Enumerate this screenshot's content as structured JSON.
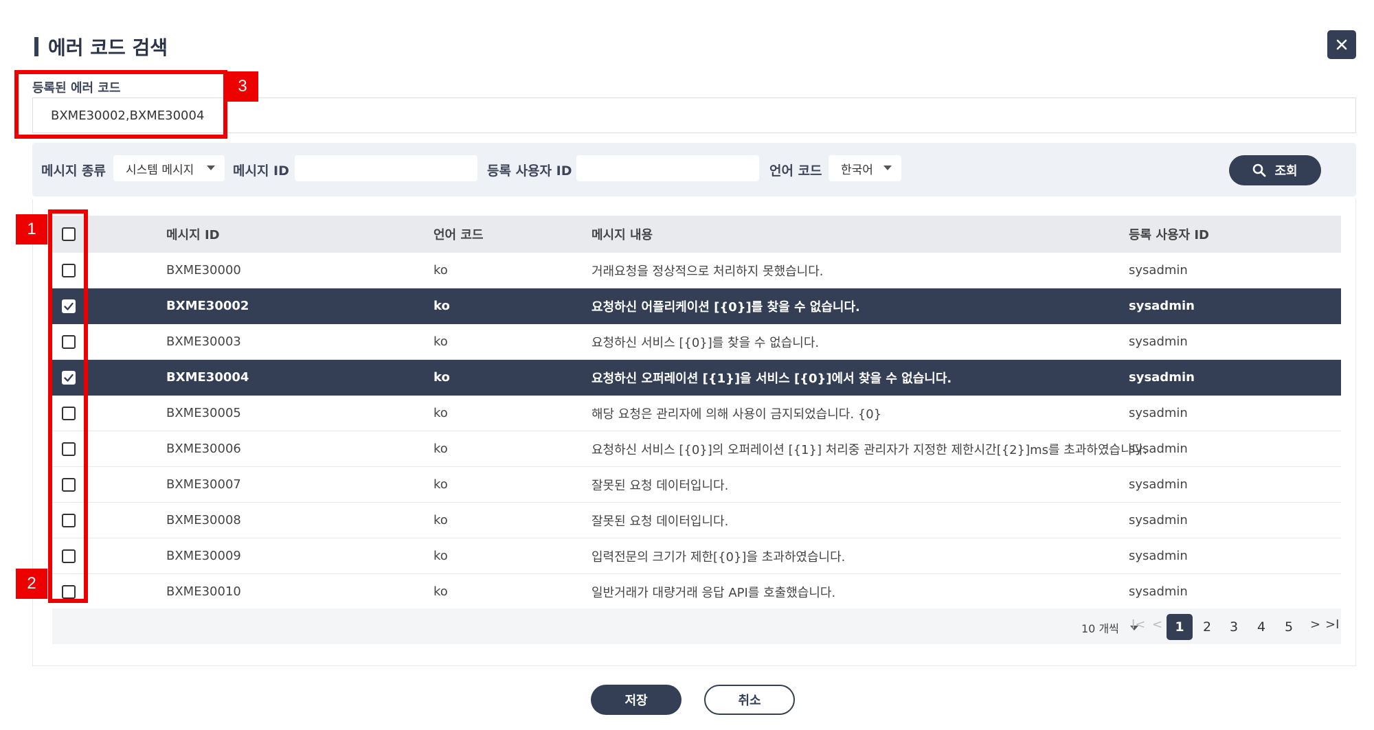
{
  "dialog": {
    "title": "에러 코드 검색",
    "close_icon": "close-icon"
  },
  "registered": {
    "label": "등록된 에러 코드",
    "value": "BXME30002,BXME30004"
  },
  "search": {
    "type_label": "메시지 종류",
    "type_value": "시스템 메시지",
    "id_label": "메시지 ID",
    "id_value": "",
    "user_label": "등록 사용자 ID",
    "user_value": "",
    "lang_label": "언어 코드",
    "lang_value": "한국어",
    "button_label": "조회",
    "button_icon": "search-icon"
  },
  "table": {
    "headers": [
      "메시지 ID",
      "언어 코드",
      "메시지 내용",
      "등록 사용자 ID"
    ],
    "rows": [
      {
        "id": "BXME30000",
        "lang": "ko",
        "msg": "거래요청을 정상적으로 처리하지 못했습니다.",
        "user": "sysadmin",
        "checked": false
      },
      {
        "id": "BXME30002",
        "lang": "ko",
        "msg": "요청하신 어플리케이션 [{0}]를 찾을 수 없습니다.",
        "user": "sysadmin",
        "checked": true
      },
      {
        "id": "BXME30003",
        "lang": "ko",
        "msg": "요청하신 서비스 [{0}]를 찾을 수 없습니다.",
        "user": "sysadmin",
        "checked": false
      },
      {
        "id": "BXME30004",
        "lang": "ko",
        "msg": "요청하신 오퍼레이션 [{1}]을 서비스 [{0}]에서 찾을 수 없습니다.",
        "user": "sysadmin",
        "checked": true
      },
      {
        "id": "BXME30005",
        "lang": "ko",
        "msg": "해당 요청은 관리자에 의해 사용이 금지되었습니다. {0}",
        "user": "sysadmin",
        "checked": false
      },
      {
        "id": "BXME30006",
        "lang": "ko",
        "msg": "요청하신 서비스 [{0}]의 오퍼레이션 [{1}] 처리중 관리자가 지정한 제한시간[{2}]ms를 초과하였습니다.",
        "user": "sysadmin",
        "checked": false
      },
      {
        "id": "BXME30007",
        "lang": "ko",
        "msg": "잘못된 요청 데이터입니다.",
        "user": "sysadmin",
        "checked": false
      },
      {
        "id": "BXME30008",
        "lang": "ko",
        "msg": "잘못된 요청 데이터입니다.",
        "user": "sysadmin",
        "checked": false
      },
      {
        "id": "BXME30009",
        "lang": "ko",
        "msg": "입력전문의 크기가 제한[{0}]을 초과하였습니다.",
        "user": "sysadmin",
        "checked": false
      },
      {
        "id": "BXME30010",
        "lang": "ko",
        "msg": "일반거래가 대량거래 응답 API를 호출했습니다.",
        "user": "sysadmin",
        "checked": false
      }
    ]
  },
  "pager": {
    "page_size": "10 개씩",
    "first": "I<",
    "prev": "<",
    "next": ">",
    "last": ">I",
    "pages": [
      "1",
      "2",
      "3",
      "4",
      "5"
    ],
    "current": "1"
  },
  "footer": {
    "save_label": "저장",
    "cancel_label": "취소"
  },
  "annotations": [
    "1",
    "2",
    "3"
  ],
  "colors": {
    "primary": "#343f55",
    "annotation": "#ee0000",
    "toolbar_bg": "#eef1f6",
    "header_bg": "#e8eaee"
  }
}
